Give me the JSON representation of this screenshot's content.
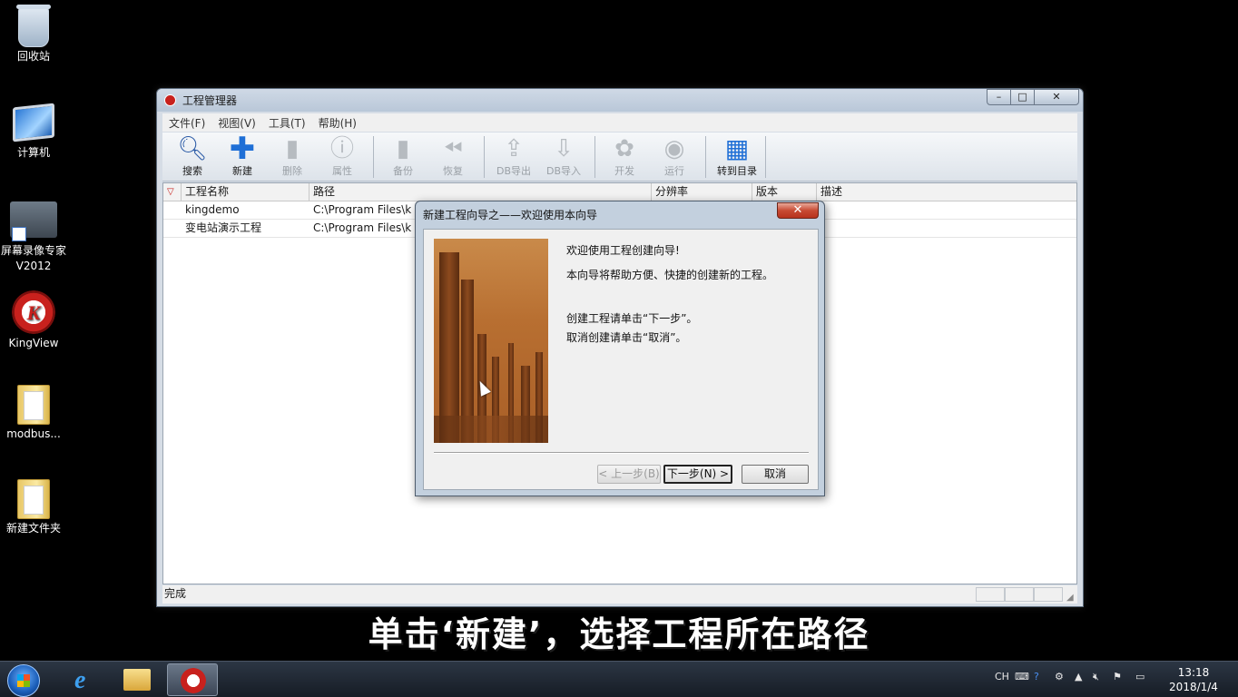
{
  "desktop": {
    "icons": [
      {
        "label": "回收站"
      },
      {
        "label": "计算机"
      },
      {
        "label": "屏幕录像专家V2012"
      },
      {
        "label": "KingView"
      },
      {
        "label": "modbus..."
      },
      {
        "label": "新建文件夹"
      }
    ]
  },
  "window": {
    "title": "工程管理器",
    "menu": [
      "文件(F)",
      "视图(V)",
      "工具(T)",
      "帮助(H)"
    ],
    "toolbar": [
      {
        "label": "搜索",
        "icon": "search-icon",
        "enabled": true
      },
      {
        "label": "新建",
        "icon": "plus-icon",
        "enabled": true
      },
      {
        "label": "删除",
        "icon": "trash-icon",
        "enabled": false
      },
      {
        "label": "属性",
        "icon": "info-icon",
        "enabled": false
      },
      {
        "label": "备份",
        "icon": "backup-icon",
        "enabled": false
      },
      {
        "label": "恢复",
        "icon": "restore-icon",
        "enabled": false
      },
      {
        "label": "DB导出",
        "icon": "upload-icon",
        "enabled": false
      },
      {
        "label": "DB导入",
        "icon": "download-icon",
        "enabled": false
      },
      {
        "label": "开发",
        "icon": "develop-icon",
        "enabled": false
      },
      {
        "label": "运行",
        "icon": "run-icon",
        "enabled": false
      },
      {
        "label": "转到目录",
        "icon": "grid-icon",
        "enabled": true
      }
    ],
    "columns": [
      "工程名称",
      "路径",
      "分辨率",
      "版本",
      "描述"
    ],
    "rows": [
      {
        "name": "kingdemo",
        "path": "C:\\Program Files\\k"
      },
      {
        "name": "变电站演示工程",
        "path": "C:\\Program Files\\k"
      }
    ],
    "status": "完成"
  },
  "wizard": {
    "title": "新建工程向导之——欢迎使用本向导",
    "lines": [
      "欢迎使用工程创建向导!",
      "本向导将帮助方便、快捷的创建新的工程。",
      "创建工程请单击“下一步”。",
      "取消创建请单击“取消”。"
    ],
    "buttons": {
      "back": "< 上一步(B)",
      "next": "下一步(N) >",
      "cancel": "取消"
    }
  },
  "subtitle": "单击‘新建’，选择工程所在路径",
  "taskbar": {
    "tray_lang": "CH",
    "time": "13:18",
    "date": "2018/1/4"
  }
}
